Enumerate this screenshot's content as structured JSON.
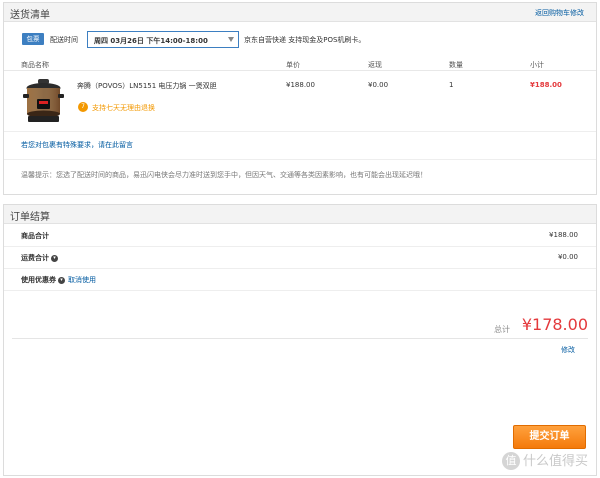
{
  "delivery": {
    "title": "送货清单",
    "back_link": "返回购物车修改",
    "shipping": {
      "badge": "包票",
      "time_label": "配送时间",
      "time_value": "周四 03月26日 下午14:00-18:00",
      "note": "京东自营快递  支持现金及POS机刷卡。"
    },
    "columns": [
      "商品名称",
      "单价",
      "返现",
      "数量",
      "小计"
    ],
    "item": {
      "name": "奔腾（POVOS）LN5151 电压力锅 一煲双胆",
      "return_badge": "7",
      "return_text": "支持七天无理由退换",
      "price": "¥188.00",
      "cashback": "¥0.00",
      "qty": "1",
      "subtotal": "¥188.00"
    },
    "remark_link": "若您对包裹有特殊要求，请在此留言",
    "tip": "温馨提示：您选了配送时间的商品，易迅闪电侠会尽力准时送到您手中，但因天气、交通等各类因素影响，也有可能会出现延迟哦！"
  },
  "settle": {
    "title": "订单结算",
    "rows": [
      {
        "label": "商品合计",
        "value": "¥188.00"
      },
      {
        "label": "运费合计",
        "value": "¥0.00"
      },
      {
        "label": "使用优惠券",
        "link": "取消使用"
      }
    ],
    "total_label": "总计",
    "total_amount": "¥178.00",
    "modify_link": "修改",
    "submit_label": "提交订单"
  },
  "watermark": {
    "icon": "值",
    "text": "什么值得买"
  },
  "colors": {
    "accent_blue": "#3d7fc1",
    "price_red": "#e4393c",
    "orange": "#f39800",
    "link": "#005aa0"
  },
  "icons": {
    "info": "info-circle-icon",
    "dropdown": "chevron-down-icon",
    "return": "seven-day-return-icon"
  }
}
